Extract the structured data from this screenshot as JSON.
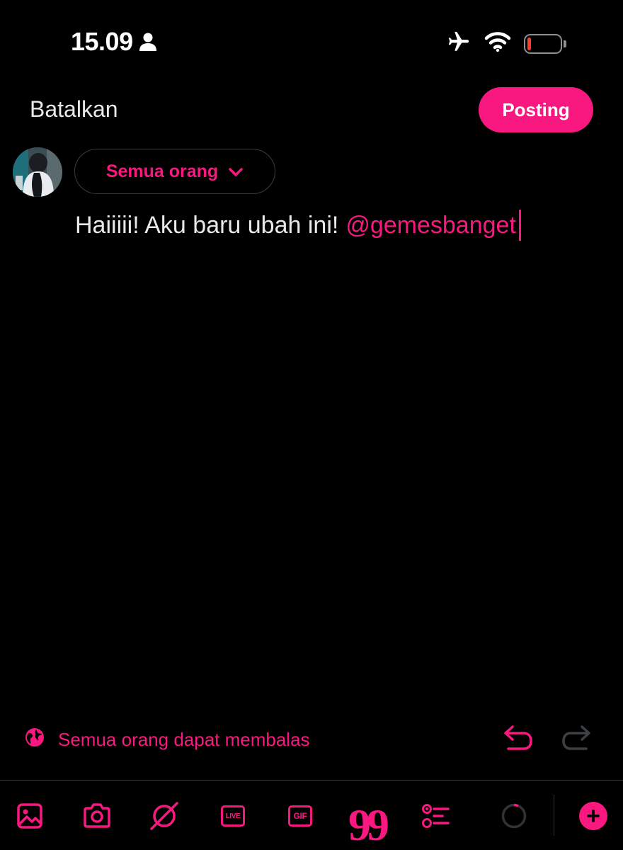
{
  "status_bar": {
    "time": "15.09",
    "battery_level": 0.12
  },
  "header": {
    "cancel_label": "Batalkan",
    "post_label": "Posting"
  },
  "audience": {
    "label": "Semua orang"
  },
  "compose": {
    "text": "Haiiiii! Aku baru ubah ini!",
    "mention": "@gemesbanget"
  },
  "reply_setting": {
    "label": "Semua orang dapat membalas"
  },
  "toolbar": {
    "live_label": "LIVE",
    "gif_label": "GIF",
    "quote_label": "99",
    "add_label": "+"
  },
  "colors": {
    "accent": "#f91880",
    "background": "#000000",
    "text": "#e7e9ea",
    "border": "#2f3336",
    "battery_low": "#ff3b30"
  },
  "icons": [
    "person-icon",
    "airplane-icon",
    "wifi-icon",
    "battery-icon",
    "chevron-down-icon",
    "globe-icon",
    "undo-icon",
    "redo-icon",
    "image-icon",
    "camera-icon",
    "spaces-icon",
    "live-icon",
    "gif-icon",
    "quote-icon",
    "poll-icon",
    "character-counter-icon",
    "add-thread-icon"
  ]
}
